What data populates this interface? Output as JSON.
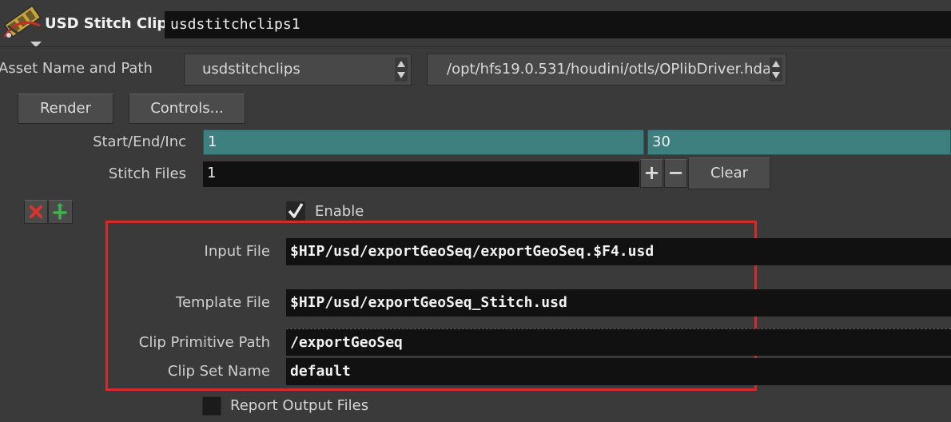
{
  "header": {
    "node_type": "USD Stitch Clips",
    "node_name": "usdstitchclips1"
  },
  "asset": {
    "label": "Asset Name and Path",
    "name_value": "usdstitchclips",
    "path_value": "/opt/hfs19.0.531/houdini/otls/OPlibDriver.hda"
  },
  "buttons": {
    "render": "Render",
    "controls": "Controls..."
  },
  "range": {
    "label": "Start/End/Inc",
    "start": "1",
    "end": "30"
  },
  "stitch": {
    "label": "Stitch Files",
    "count": "1",
    "plus": "+",
    "minus": "−",
    "clear": "Clear"
  },
  "multiparm": {
    "enable_label": "Enable",
    "enable_checked": true,
    "input_file_label": "Input File",
    "input_file_value": "$HIP/usd/exportGeoSeq/exportGeoSeq.$F4.usd",
    "template_file_label": "Template File",
    "template_file_value": "$HIP/usd/exportGeoSeq_Stitch.usd",
    "clip_prim_label": "Clip Primitive Path",
    "clip_prim_value": "/exportGeoSeq",
    "clip_set_label": "Clip Set Name",
    "clip_set_value": "default"
  },
  "report": {
    "label": "Report Output Files",
    "checked": false
  },
  "colors": {
    "background": "#3a3a3a",
    "field": "#111111",
    "teal_field": "#3e7f7f",
    "highlight_box": "#d42a2a"
  }
}
